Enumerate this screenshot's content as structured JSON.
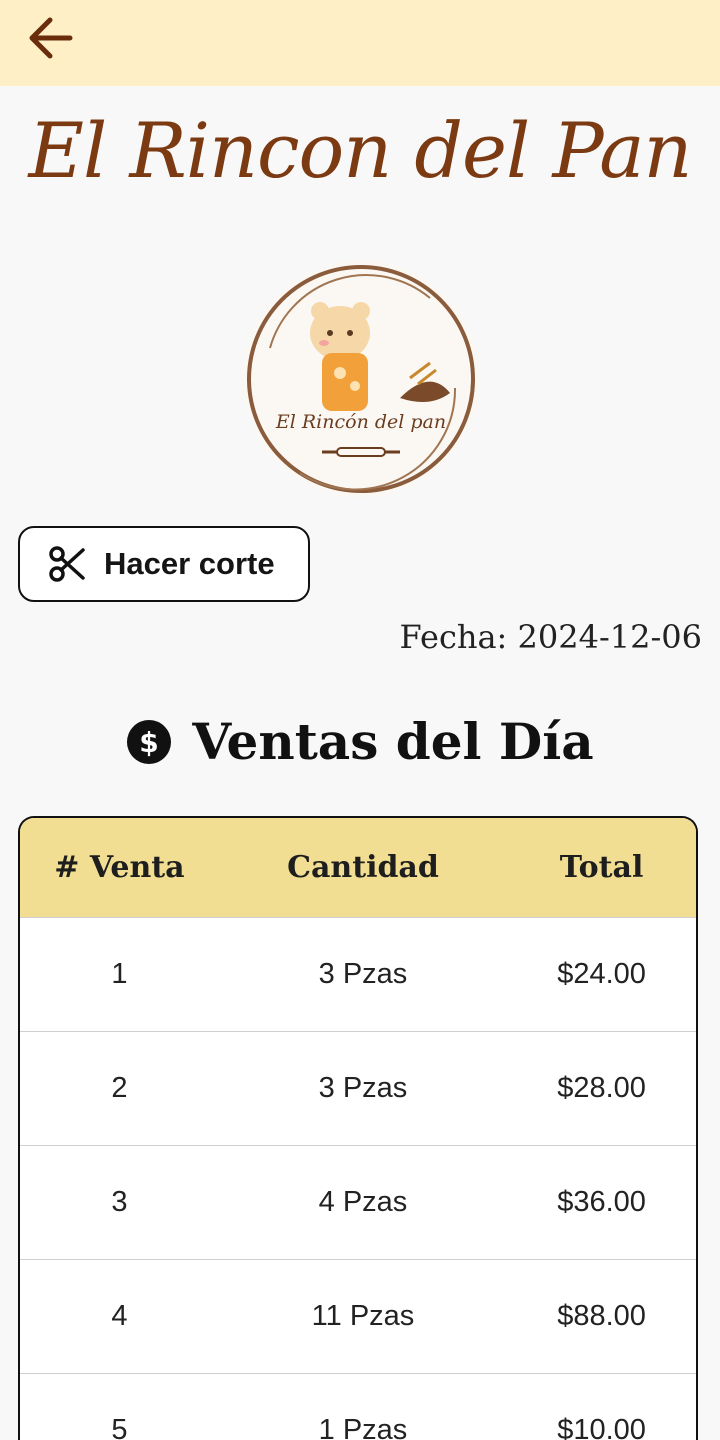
{
  "app": {
    "title": "El Rincon del Pan",
    "logo_text": "El Rincón del pan"
  },
  "actions": {
    "cut_label": "Hacer corte"
  },
  "date": {
    "label": "Fecha: 2024-12-06"
  },
  "sales": {
    "title": "Ventas del Día",
    "headers": [
      "# Venta",
      "Cantidad",
      "Total"
    ],
    "rows": [
      {
        "id": "1",
        "qty": "3 Pzas",
        "total": "$24.00"
      },
      {
        "id": "2",
        "qty": "3 Pzas",
        "total": "$28.00"
      },
      {
        "id": "3",
        "qty": "4 Pzas",
        "total": "$36.00"
      },
      {
        "id": "4",
        "qty": "11 Pzas",
        "total": "$88.00"
      },
      {
        "id": "5",
        "qty": "1 Pzas",
        "total": "$10.00"
      }
    ]
  },
  "colors": {
    "topbar": "#ffefc7",
    "brand": "#7b3a12",
    "table_header": "#f2de92"
  }
}
